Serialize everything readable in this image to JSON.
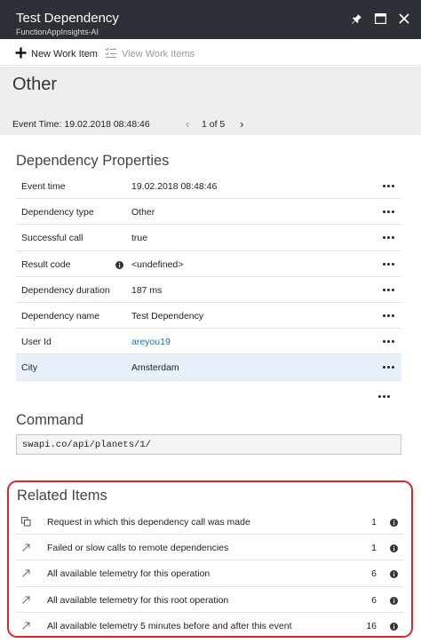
{
  "window": {
    "title": "Test Dependency",
    "subtitle": "FunctionAppInsights-AI",
    "icons": [
      "pin-icon",
      "maximize-icon",
      "close-icon"
    ]
  },
  "toolbar": {
    "new_work_item": "New Work Item",
    "view_work_items": "View Work Items"
  },
  "header": {
    "title": "Other",
    "event_time_label": "Event Time: 19.02.2018 08:48:46",
    "pager": "1 of 5"
  },
  "dependency_properties": {
    "title": "Dependency Properties",
    "rows": [
      {
        "key": "Event time",
        "value": "19.02.2018 08:48:46"
      },
      {
        "key": "Dependency type",
        "value": "Other"
      },
      {
        "key": "Successful call",
        "value": "true"
      },
      {
        "key": "Result code",
        "value": "<undefined>"
      },
      {
        "key": "Dependency duration",
        "value": "187 ms"
      },
      {
        "key": "Dependency name",
        "value": "Test Dependency"
      },
      {
        "key": "User Id",
        "value": "areyou19"
      },
      {
        "key": "City",
        "value": "Amsterdam"
      }
    ]
  },
  "command": {
    "title": "Command",
    "value": "swapi.co/api/planets/1/"
  },
  "related": {
    "title": "Related Items",
    "rows": [
      {
        "label": "Request in which this dependency call was made",
        "count": "1",
        "icon": "copy-icon"
      },
      {
        "label": "Failed or slow calls to remote dependencies",
        "count": "1",
        "icon": "arrow-up-right-icon"
      },
      {
        "label": "All available telemetry for this operation",
        "count": "6",
        "icon": "arrow-up-right-icon"
      },
      {
        "label": "All available telemetry for this root operation",
        "count": "6",
        "icon": "arrow-up-right-icon"
      },
      {
        "label": "All available telemetry 5 minutes before and after this event",
        "count": "16",
        "icon": "arrow-up-right-icon"
      }
    ]
  },
  "colors": {
    "titlebar": "#2b3136",
    "header_bg": "#eeeeee",
    "link": "#1f6fb7",
    "highlight_border": "#d9262b",
    "selected_row": "#e8f1fa"
  }
}
